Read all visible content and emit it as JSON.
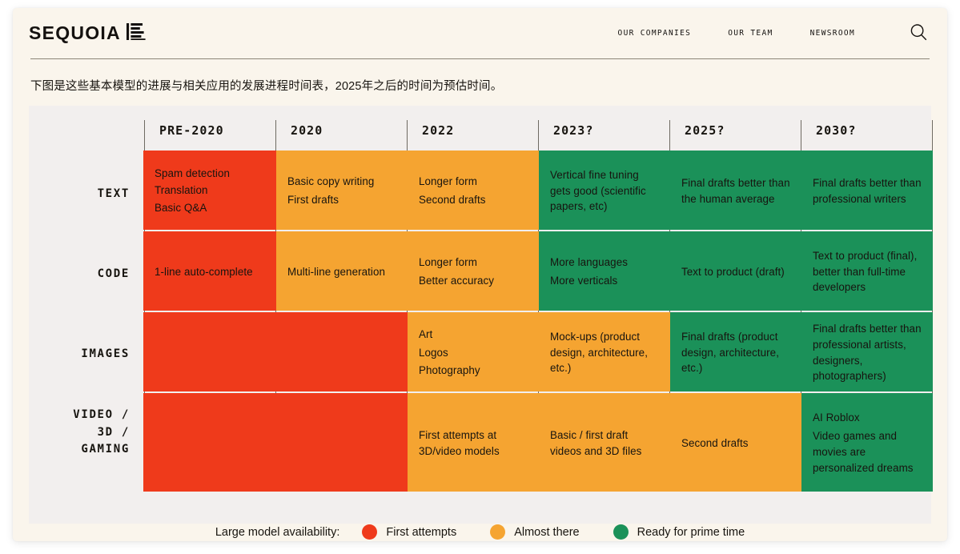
{
  "header": {
    "logo_word": "SEQUOIA",
    "logo_mark_name": "sequoia-mark-icon",
    "nav": [
      {
        "label": "OUR COMPANIES"
      },
      {
        "label": "OUR TEAM"
      },
      {
        "label": "NEWSROOM"
      }
    ],
    "search_icon": "search-icon"
  },
  "caption": "下图是这些基本模型的进展与相关应用的发展进程时间表，2025年之后的时间为预估时间。",
  "colors": {
    "red": "#ef3a1b",
    "amber": "#f5a431",
    "green": "#1b9159",
    "card_bg": "#faf5ec",
    "panel_bg": "#f2efee",
    "ink": "#17140f",
    "rule": "#6e6a62"
  },
  "chart_data": {
    "type": "table",
    "title": "",
    "columns": [
      "PRE-2020",
      "2020",
      "2022",
      "2023?",
      "2025?",
      "2030?"
    ],
    "rows": [
      "TEXT",
      "CODE",
      "IMAGES",
      "VIDEO /\n3D /\nGAMING"
    ],
    "legend_position": "bottom-center",
    "legend": {
      "title": "Large model availability:",
      "items": [
        {
          "label": "First attempts",
          "color": "#ef3a1b",
          "status": "red"
        },
        {
          "label": "Almost there",
          "color": "#f5a431",
          "status": "amber"
        },
        {
          "label": "Ready for prime time",
          "color": "#1b9159",
          "status": "green"
        }
      ]
    },
    "cells": [
      {
        "row": "TEXT",
        "column": "PRE-2020",
        "status": "red",
        "lines": [
          "Spam detection",
          "Translation",
          "Basic Q&A"
        ]
      },
      {
        "row": "TEXT",
        "column": "2020",
        "status": "amber",
        "lines": [
          "Basic copy writing",
          "First drafts"
        ]
      },
      {
        "row": "TEXT",
        "column": "2022",
        "status": "amber",
        "lines": [
          "Longer form",
          "Second drafts"
        ]
      },
      {
        "row": "TEXT",
        "column": "2023?",
        "status": "green",
        "lines": [
          "Vertical fine tuning gets good (scientific papers, etc)"
        ]
      },
      {
        "row": "TEXT",
        "column": "2025?",
        "status": "green",
        "lines": [
          "Final drafts better than the human average"
        ]
      },
      {
        "row": "TEXT",
        "column": "2030?",
        "status": "green",
        "lines": [
          "Final drafts better than professional writers"
        ]
      },
      {
        "row": "CODE",
        "column": "PRE-2020",
        "status": "red",
        "lines": [
          "1-line auto-complete"
        ]
      },
      {
        "row": "CODE",
        "column": "2020",
        "status": "amber",
        "lines": [
          "Multi-line generation"
        ]
      },
      {
        "row": "CODE",
        "column": "2022",
        "status": "amber",
        "lines": [
          "Longer form",
          "Better accuracy"
        ]
      },
      {
        "row": "CODE",
        "column": "2023?",
        "status": "green",
        "lines": [
          "More languages",
          "More verticals"
        ]
      },
      {
        "row": "CODE",
        "column": "2025?",
        "status": "green",
        "lines": [
          "Text to product (draft)"
        ]
      },
      {
        "row": "CODE",
        "column": "2030?",
        "status": "green",
        "lines": [
          "Text to product (final), better than full-time developers"
        ]
      },
      {
        "row": "IMAGES",
        "column": "PRE-2020",
        "status": "red",
        "lines": []
      },
      {
        "row": "IMAGES",
        "column": "2020",
        "status": "red",
        "lines": []
      },
      {
        "row": "IMAGES",
        "column": "2022",
        "status": "amber",
        "lines": [
          "Art",
          "Logos",
          "Photography"
        ]
      },
      {
        "row": "IMAGES",
        "column": "2023?",
        "status": "amber",
        "lines": [
          "Mock-ups (product design, architecture, etc.)"
        ]
      },
      {
        "row": "IMAGES",
        "column": "2025?",
        "status": "green",
        "lines": [
          "Final drafts (product design, architecture, etc.)"
        ]
      },
      {
        "row": "IMAGES",
        "column": "2030?",
        "status": "green",
        "lines": [
          "Final drafts better than professional artists, designers, photographers)"
        ]
      },
      {
        "row": "VIDEO / 3D / GAMING",
        "column": "PRE-2020",
        "status": "red",
        "lines": []
      },
      {
        "row": "VIDEO / 3D / GAMING",
        "column": "2020",
        "status": "red",
        "lines": []
      },
      {
        "row": "VIDEO / 3D / GAMING",
        "column": "2022",
        "status": "amber",
        "lines": [
          "First attempts at 3D/video models"
        ]
      },
      {
        "row": "VIDEO / 3D / GAMING",
        "column": "2023?",
        "status": "amber",
        "lines": [
          "Basic / first draft videos and 3D files"
        ]
      },
      {
        "row": "VIDEO / 3D / GAMING",
        "column": "2025?",
        "status": "amber",
        "lines": [
          "Second drafts"
        ]
      },
      {
        "row": "VIDEO / 3D / GAMING",
        "column": "2030?",
        "status": "green",
        "lines": [
          "AI Roblox",
          "Video games and movies are personalized dreams"
        ]
      }
    ]
  }
}
